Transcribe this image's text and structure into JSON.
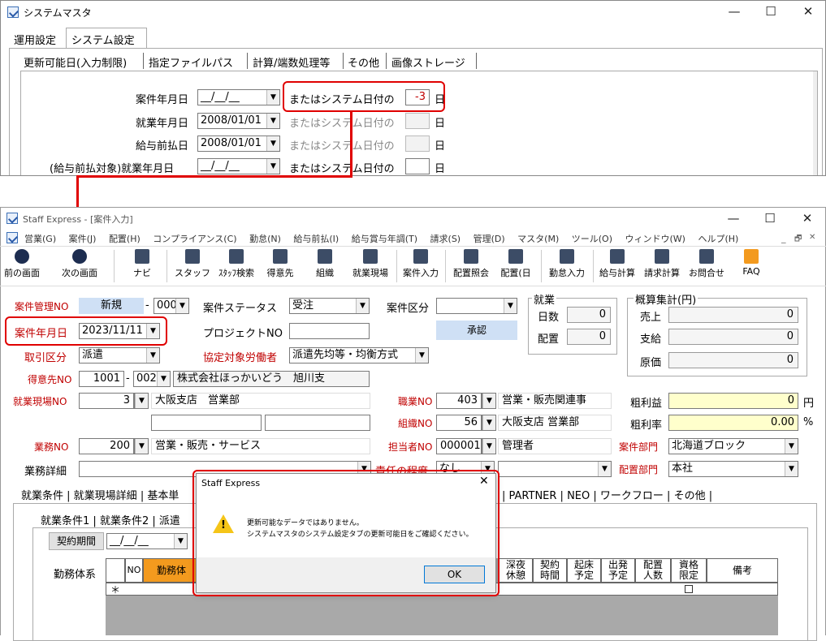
{
  "top_window": {
    "title": "システムマスタ",
    "controls": [
      "—",
      "☐",
      "✕"
    ],
    "tabs": [
      "運用設定",
      "システム設定"
    ],
    "subtabs": [
      "更新可能日(入力制限)",
      "指定ファイルパス",
      "計算/端数処理等",
      "その他",
      "画像ストレージ"
    ],
    "rows": [
      {
        "label": "案件年月日",
        "date": "__/__/__",
        "or_text": "またはシステム日付の",
        "offset": "-3",
        "unit": "日"
      },
      {
        "label": "就業年月日",
        "date": "2008/01/01",
        "or_text": "またはシステム日付の",
        "offset": "",
        "unit": "日"
      },
      {
        "label": "給与前払日",
        "date": "2008/01/01",
        "or_text": "またはシステム日付の",
        "offset": "",
        "unit": "日"
      },
      {
        "label": "(給与前払対象)就業年月日",
        "date": "__/__/__",
        "or_text": "またはシステム日付の",
        "offset": "",
        "unit": "日"
      }
    ]
  },
  "main_window": {
    "title": "Staff Express - [案件入力]",
    "controls": [
      "—",
      "☐",
      "✕"
    ],
    "menu": [
      "営業(G)",
      "案件(J)",
      "配置(H)",
      "コンプライアンス(C)",
      "勤怠(N)",
      "給与前払(I)",
      "給与賞与年調(T)",
      "請求(S)",
      "管理(D)",
      "マスタ(M)",
      "ツール(O)",
      "ウィンドウ(W)",
      "ヘルプ(H)"
    ],
    "mdi_controls": [
      "_",
      "🗗",
      "✕"
    ],
    "toolbar": [
      "前の画面",
      "次の画面",
      "ナビ",
      "スタッフ",
      "ｽﾀｯﾌ検索",
      "得意先",
      "組織",
      "就業現場",
      "案件入力",
      "配置照会",
      "配置(日",
      "勤怠入力",
      "給与計算",
      "請求計算",
      "お問合せ",
      "FAQ"
    ],
    "form": {
      "case_no_label": "案件管理NO",
      "case_no": "新規",
      "case_branch": "000",
      "status_label": "案件ステータス",
      "status": "受注",
      "category_label": "案件区分",
      "category": "",
      "case_date_label": "案件年月日",
      "case_date": "2023/11/11",
      "project_label": "プロジェクトNO",
      "project": "",
      "approve": "承認",
      "trade_label": "取引区分",
      "trade": "派遣",
      "agree_label": "協定対象労働者",
      "agree": "派遣先均等・均衡方式",
      "client_label": "得意先NO",
      "client_no": "1001",
      "client_branch": "002",
      "client_name": "株式会社ほっかいどう　旭川支",
      "site_label": "就業現場NO",
      "site_no": "3",
      "site_name": "大阪支店　営業部",
      "job_label": "職業NO",
      "job_no": "403",
      "job_name": "営業・販売関連事",
      "org_label": "組織NO",
      "org_no": "56",
      "org_name": "大阪支店 営業部",
      "work_label": "業務NO",
      "work_no": "200",
      "work_name": "営業・販売・サービス",
      "staff_label": "担当者NO",
      "staff_no": "000001",
      "staff_name": "管理者",
      "dept_label": "案件部門",
      "dept": "北海道ブロック",
      "detail_label": "業務詳細",
      "detail": "",
      "resp_label": "責任の程度",
      "resp": "なし",
      "place_label": "配置部門",
      "place": "本社",
      "gross_label": "粗利益",
      "gross": "0",
      "gross_unit": "円",
      "rate_label": "粗利率",
      "rate": "0.00",
      "rate_unit": "%"
    },
    "employment": {
      "title": "就業",
      "days_label": "日数",
      "days": "0",
      "assign_label": "配置",
      "assign": "0"
    },
    "estimate": {
      "title": "概算集計(円)",
      "sales_label": "売上",
      "sales": "0",
      "pay_label": "支給",
      "pay": "0",
      "cost_label": "原価",
      "cost": "0"
    },
    "tabs": [
      "就業条件",
      "就業現場詳細",
      "基本単",
      "PARTNER",
      "NEO",
      "ワークフロー",
      "その他"
    ],
    "subtabs": [
      "就業条件1",
      "就業条件2",
      "派遣"
    ],
    "contract_btn": "契約期間",
    "contract_date": "__/__/__",
    "work_system": "勤務体系",
    "grid_headers": [
      "NO",
      "勤務体",
      "深夜休憩",
      "契約時間",
      "起床予定",
      "出発予定",
      "配置人数",
      "資格限定",
      "備考"
    ],
    "new_row_marker": "＊"
  },
  "dialog": {
    "title": "Staff Express",
    "close": "✕",
    "line1": "更新可能なデータではありません。",
    "line2": "システムマスタのシステム設定タブの更新可能日をご確認ください。",
    "ok": "OK"
  }
}
